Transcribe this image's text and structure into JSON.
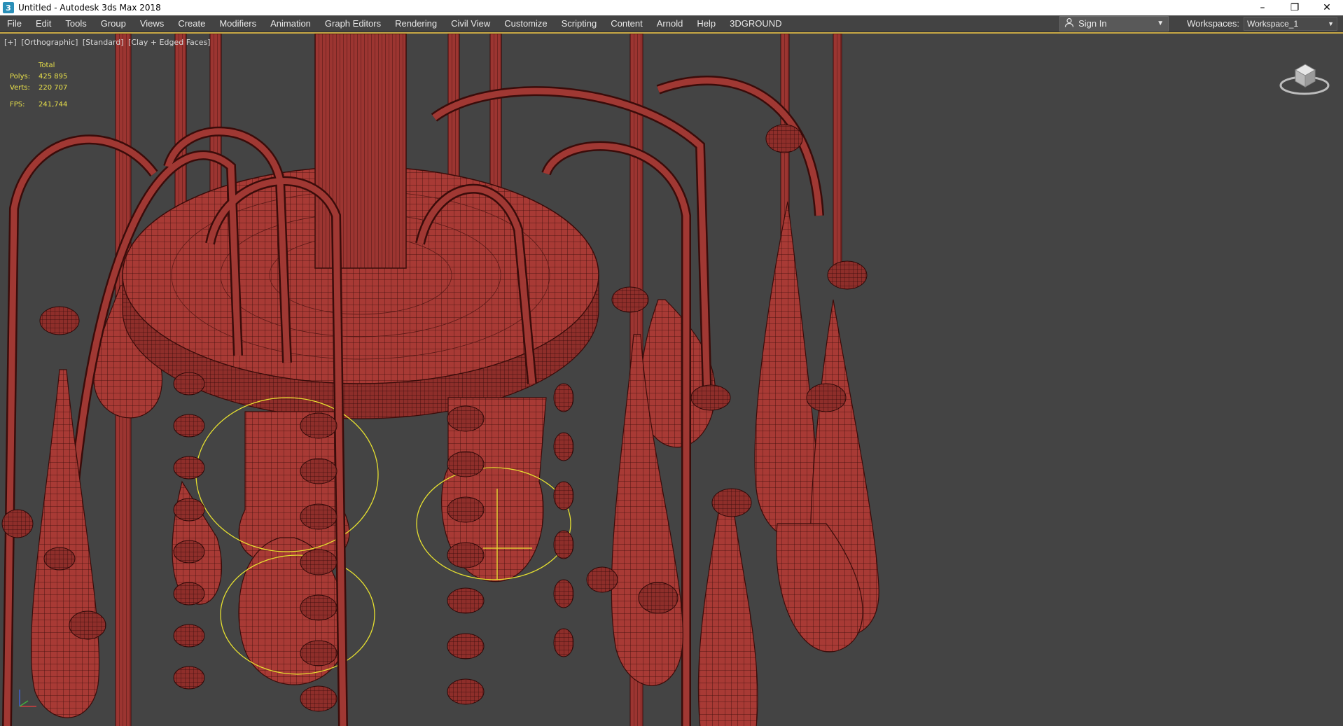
{
  "window": {
    "title": "Untitled - Autodesk 3ds Max 2018",
    "app_icon": "3",
    "controls": {
      "minimize": "–",
      "restore": "❐",
      "close": "✕"
    }
  },
  "menu": {
    "items": [
      "File",
      "Edit",
      "Tools",
      "Group",
      "Views",
      "Create",
      "Modifiers",
      "Animation",
      "Graph Editors",
      "Rendering",
      "Civil View",
      "Customize",
      "Scripting",
      "Content",
      "Arnold",
      "Help",
      "3DGROUND"
    ],
    "sign_in": "Sign In",
    "workspaces_label": "Workspaces:",
    "workspace_value": "Workspace_1"
  },
  "viewport": {
    "labels": [
      "[+]",
      "[Orthographic]",
      "[Standard]",
      "[Clay + Edged Faces]"
    ],
    "stats": {
      "header": "Total",
      "polys_label": "Polys:",
      "polys_value": "425 895",
      "verts_label": "Verts:",
      "verts_value": "220 707",
      "fps_label": "FPS:",
      "fps_value": "241,744"
    }
  },
  "colors": {
    "clay": "#b0403a",
    "clay_dark": "#6e1e1b",
    "wire": "#3a0c0a",
    "selection": "#e6e030",
    "viewport_bg": "#444444"
  }
}
